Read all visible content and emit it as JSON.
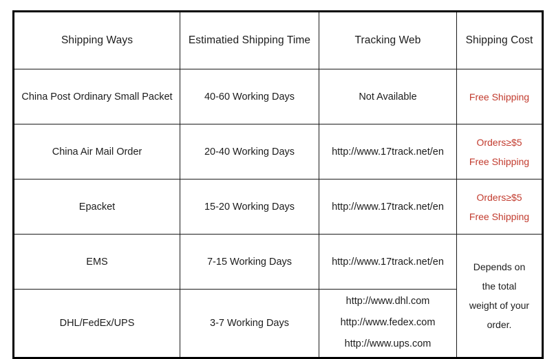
{
  "table": {
    "headers": [
      "Shipping Ways",
      "Estimatied Shipping Time",
      "Tracking Web",
      "Shipping Cost"
    ],
    "rows": [
      {
        "way": "China Post Ordinary Small Packet",
        "time": "40-60 Working Days",
        "tracking": "Not Available",
        "cost_lines": [
          "Free Shipping"
        ],
        "cost_color": "red"
      },
      {
        "way": "China Air Mail Order",
        "time": "20-40 Working Days",
        "tracking": "http://www.17track.net/en",
        "cost_lines": [
          "Orders≥$5",
          "Free Shipping"
        ],
        "cost_color": "red"
      },
      {
        "way": "Epacket",
        "time": "15-20 Working Days",
        "tracking": "http://www.17track.net/en",
        "cost_lines": [
          "Orders≥$5",
          "Free Shipping"
        ],
        "cost_color": "red"
      },
      {
        "way": "EMS",
        "time": "7-15 Working Days",
        "tracking": "http://www.17track.net/en",
        "cost_lines": [
          "Depends on",
          "the total",
          "weight of your",
          "order."
        ],
        "cost_color": "black",
        "cost_rowspan": 2
      },
      {
        "way": "DHL/FedEx/UPS",
        "time": "3-7 Working Days",
        "tracking_lines": [
          "http://www.dhl.com",
          "http://www.fedex.com",
          "http://www.ups.com"
        ],
        "cost_lines": [],
        "cost_color": "none"
      }
    ]
  },
  "colors": {
    "red_text": "#c23b2e",
    "black_text": "#1c1c1c",
    "border": "#000000",
    "background": "#ffffff"
  }
}
